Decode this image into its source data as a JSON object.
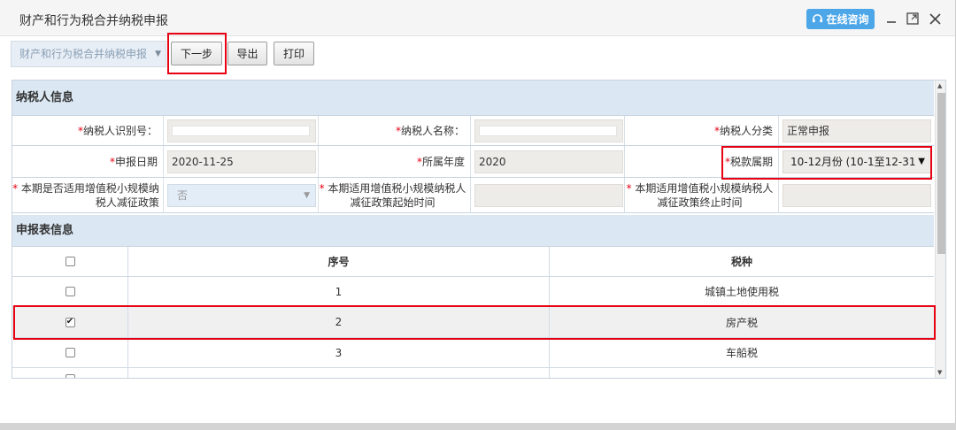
{
  "window": {
    "title": "财产和行为税合并纳税申报",
    "consult_label": "在线咨询"
  },
  "toolbar": {
    "dropdown_value": "财产和行为税合并纳税申报",
    "next_label": "下一步",
    "export_label": "导出",
    "print_label": "打印"
  },
  "taxpayer": {
    "section_title": "纳税人信息",
    "id_label": "纳税人识别号：",
    "id_value": "",
    "name_label": "纳税人名称：",
    "name_value": "",
    "category_label": "纳税人分类",
    "category_value": "正常申报",
    "date_label": "申报日期",
    "date_value": "2020-11-25",
    "year_label": "所属年度",
    "year_value": "2020",
    "period_label": "税款属期",
    "period_value": "10-12月份 (10-1至12-31",
    "policy_label_line1": "本期是否适用增值税小规模纳",
    "policy_label_line2": "税人减征政策",
    "policy_value": "否",
    "start_label_line1": "本期适用增值税小规模纳税人",
    "start_label_line2": "减征政策起始时间",
    "end_label_line1": "本期适用增值税小规模纳税人",
    "end_label_line2": "减征政策终止时间"
  },
  "declaration": {
    "section_title": "申报表信息",
    "col_no": "序号",
    "col_tax": "税种",
    "rows": [
      {
        "no": "1",
        "tax": "城镇土地使用税",
        "checked": false
      },
      {
        "no": "2",
        "tax": "房产税",
        "checked": true
      },
      {
        "no": "3",
        "tax": "车船税",
        "checked": false
      }
    ]
  },
  "colors": {
    "accent": "#4ca6e8",
    "highlight": "#e60012",
    "section_bg": "#dbe8f4"
  }
}
